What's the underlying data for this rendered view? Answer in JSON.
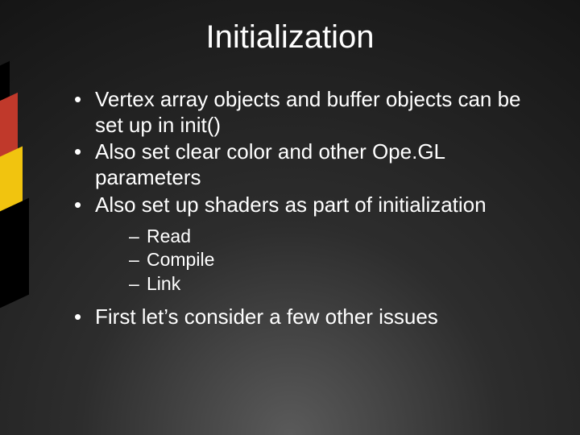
{
  "title": "Initialization",
  "bullets": [
    {
      "text": "Vertex array objects and buffer objects can be set up in init()"
    },
    {
      "text": "Also set clear color and other Ope.GL parameters"
    },
    {
      "text": "Also set up shaders as part of initialization",
      "sub": [
        "Read",
        "Compile",
        "Link"
      ]
    },
    {
      "text": "First let’s consider a few other issues"
    }
  ]
}
